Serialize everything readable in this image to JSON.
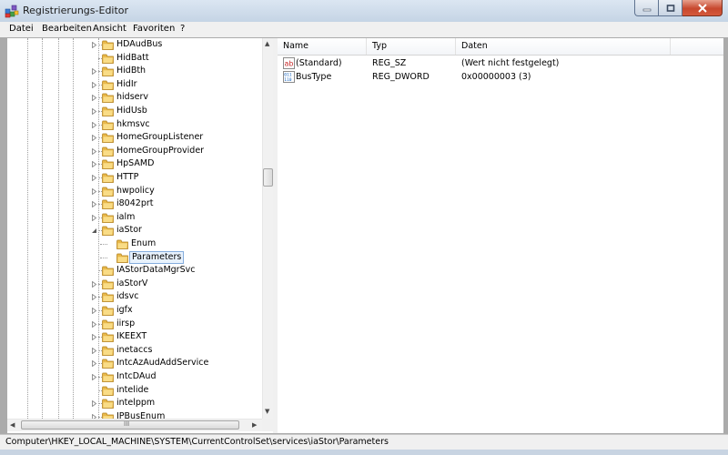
{
  "window": {
    "title": "Registrierungs-Editor",
    "min_icon": "minimize-icon",
    "max_icon": "maximize-icon",
    "close_icon": "close-icon"
  },
  "menu": [
    "Datei",
    "Bearbeiten",
    "Ansicht",
    "Favoriten",
    "?"
  ],
  "tree": {
    "items": [
      {
        "label": "HDAudBus",
        "level": 0,
        "expander": "collapsed"
      },
      {
        "label": "HidBatt",
        "level": 0,
        "expander": "none"
      },
      {
        "label": "HidBth",
        "level": 0,
        "expander": "collapsed"
      },
      {
        "label": "HidIr",
        "level": 0,
        "expander": "collapsed"
      },
      {
        "label": "hidserv",
        "level": 0,
        "expander": "collapsed"
      },
      {
        "label": "HidUsb",
        "level": 0,
        "expander": "collapsed"
      },
      {
        "label": "hkmsvc",
        "level": 0,
        "expander": "collapsed"
      },
      {
        "label": "HomeGroupListener",
        "level": 0,
        "expander": "collapsed"
      },
      {
        "label": "HomeGroupProvider",
        "level": 0,
        "expander": "collapsed"
      },
      {
        "label": "HpSAMD",
        "level": 0,
        "expander": "collapsed"
      },
      {
        "label": "HTTP",
        "level": 0,
        "expander": "collapsed"
      },
      {
        "label": "hwpolicy",
        "level": 0,
        "expander": "collapsed"
      },
      {
        "label": "i8042prt",
        "level": 0,
        "expander": "collapsed"
      },
      {
        "label": "ialm",
        "level": 0,
        "expander": "collapsed"
      },
      {
        "label": "iaStor",
        "level": 0,
        "expander": "expanded"
      },
      {
        "label": "Enum",
        "level": 1,
        "expander": "none"
      },
      {
        "label": "Parameters",
        "level": 1,
        "expander": "none",
        "selected": true
      },
      {
        "label": "IAStorDataMgrSvc",
        "level": 0,
        "expander": "none"
      },
      {
        "label": "iaStorV",
        "level": 0,
        "expander": "collapsed"
      },
      {
        "label": "idsvc",
        "level": 0,
        "expander": "collapsed"
      },
      {
        "label": "igfx",
        "level": 0,
        "expander": "collapsed"
      },
      {
        "label": "iirsp",
        "level": 0,
        "expander": "collapsed"
      },
      {
        "label": "IKEEXT",
        "level": 0,
        "expander": "collapsed"
      },
      {
        "label": "inetaccs",
        "level": 0,
        "expander": "collapsed"
      },
      {
        "label": "IntcAzAudAddService",
        "level": 0,
        "expander": "collapsed"
      },
      {
        "label": "IntcDAud",
        "level": 0,
        "expander": "collapsed"
      },
      {
        "label": "intelide",
        "level": 0,
        "expander": "none"
      },
      {
        "label": "intelppm",
        "level": 0,
        "expander": "collapsed"
      },
      {
        "label": "IPBusEnum",
        "level": 0,
        "expander": "collapsed"
      }
    ],
    "hscroll_mark": "III"
  },
  "list": {
    "columns": [
      "Name",
      "Typ",
      "Daten"
    ],
    "rows": [
      {
        "icon": "string-value-icon",
        "name": "(Standard)",
        "type": "REG_SZ",
        "data": "(Wert nicht festgelegt)"
      },
      {
        "icon": "dword-value-icon",
        "name": "BusType",
        "type": "REG_DWORD",
        "data": "0x00000003 (3)"
      }
    ]
  },
  "status": {
    "path": "Computer\\HKEY_LOCAL_MACHINE\\SYSTEM\\CurrentControlSet\\services\\iaStor\\Parameters"
  },
  "colors": {
    "selection_border": "#84acdd",
    "selection_fill": "#e8f2fd",
    "folder": "#e8b84a",
    "close_button": "#c7482e"
  }
}
